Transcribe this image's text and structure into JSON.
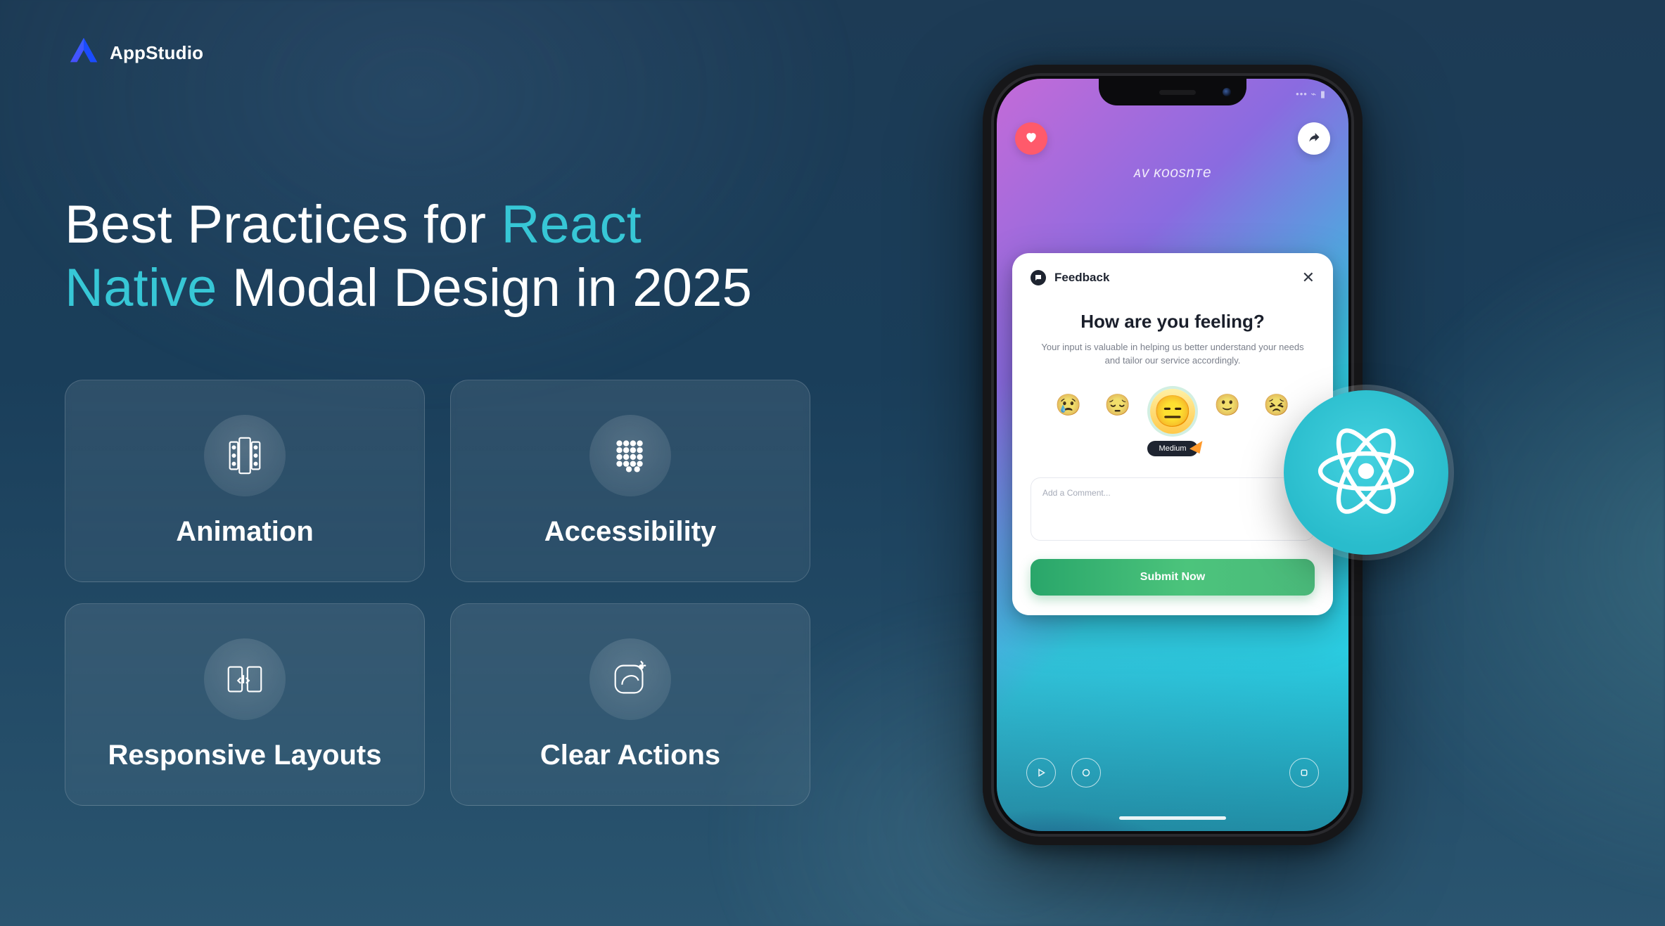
{
  "logo_text": "AppStudio",
  "heading": {
    "line1_plain": "Best Practices for ",
    "line1_accent": "React",
    "line2_accent": "Native",
    "line2_plain": " Modal Design in 2025"
  },
  "features": {
    "animation": "Animation",
    "accessibility": "Accessibility",
    "responsive": "Responsive Layouts",
    "clear_actions": "Clear Actions"
  },
  "phone": {
    "status_time": "",
    "brand": "ᴀᴠ ᴋᴏᴏsnᴛe",
    "modal": {
      "title": "Feedback",
      "question": "How are you feeling?",
      "description": "Your input is valuable in helping us better understand your needs and tailor our service accordingly.",
      "emojis": {
        "e0": "😢",
        "e1": "😔",
        "e2": "😑",
        "e3": "🙂",
        "e4": "😣"
      },
      "selected_label": "Medium",
      "comment_placeholder": "Add a Comment...",
      "submit_label": "Submit Now"
    }
  },
  "colors": {
    "accent": "#37c7d6",
    "react_badge": "#34c8d7",
    "submit_green": "#3fb975"
  }
}
